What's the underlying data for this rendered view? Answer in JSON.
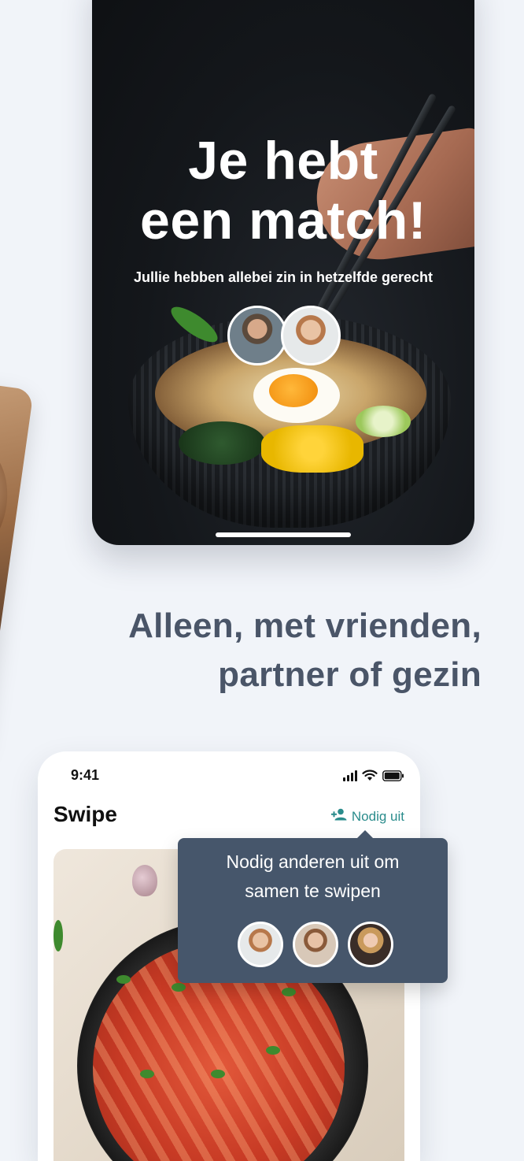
{
  "match_screen": {
    "title_line1": "Je hebt",
    "title_line2": "een match!",
    "subtitle": "Jullie hebben allebei zin in hetzelfde gerecht",
    "avatars": [
      "avatar-user-1",
      "avatar-user-2"
    ]
  },
  "tagline": {
    "line1": "Alleen, met vrienden,",
    "line2": "partner of gezin"
  },
  "phone": {
    "status_bar": {
      "time": "9:41",
      "icons": [
        "signal-icon",
        "wifi-icon",
        "battery-icon"
      ]
    },
    "title": "Swipe",
    "invite": {
      "label": "Nodig uit",
      "icon": "person-add-icon"
    }
  },
  "tooltip": {
    "line1": "Nodig anderen uit om",
    "line2": "samen te swipen",
    "avatars": [
      "avatar-1",
      "avatar-2",
      "avatar-3"
    ]
  },
  "colors": {
    "background": "#f1f4f9",
    "tagline": "#4a5568",
    "accent": "#2a8c8c",
    "tooltip": "#46566b"
  }
}
